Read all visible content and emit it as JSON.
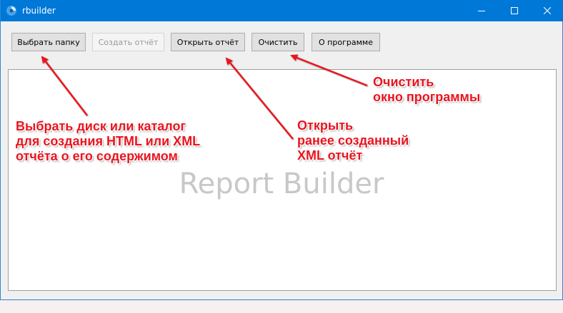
{
  "window": {
    "title": "rbuilder",
    "colors": {
      "titlebar": "#0078d7",
      "annotation": "#e8151f"
    },
    "controls": {
      "minimize_icon": "minimize-icon",
      "maximize_icon": "maximize-icon",
      "close_icon": "close-icon"
    }
  },
  "toolbar": {
    "select_folder": "Выбрать папку",
    "create_report": "Создать отчёт",
    "open_report": "Открыть отчёт",
    "clear": "Очистить",
    "about": "О программе"
  },
  "main": {
    "watermark": "Report Builder"
  },
  "annotations": {
    "select_folder": [
      "Выбрать диск или каталог",
      "для создания HTML или XML",
      "отчёта о его содержимом"
    ],
    "open_report": [
      "Открыть",
      "ранее созданный",
      "XML отчёт"
    ],
    "clear": [
      "Очистить",
      "окно программы"
    ]
  }
}
